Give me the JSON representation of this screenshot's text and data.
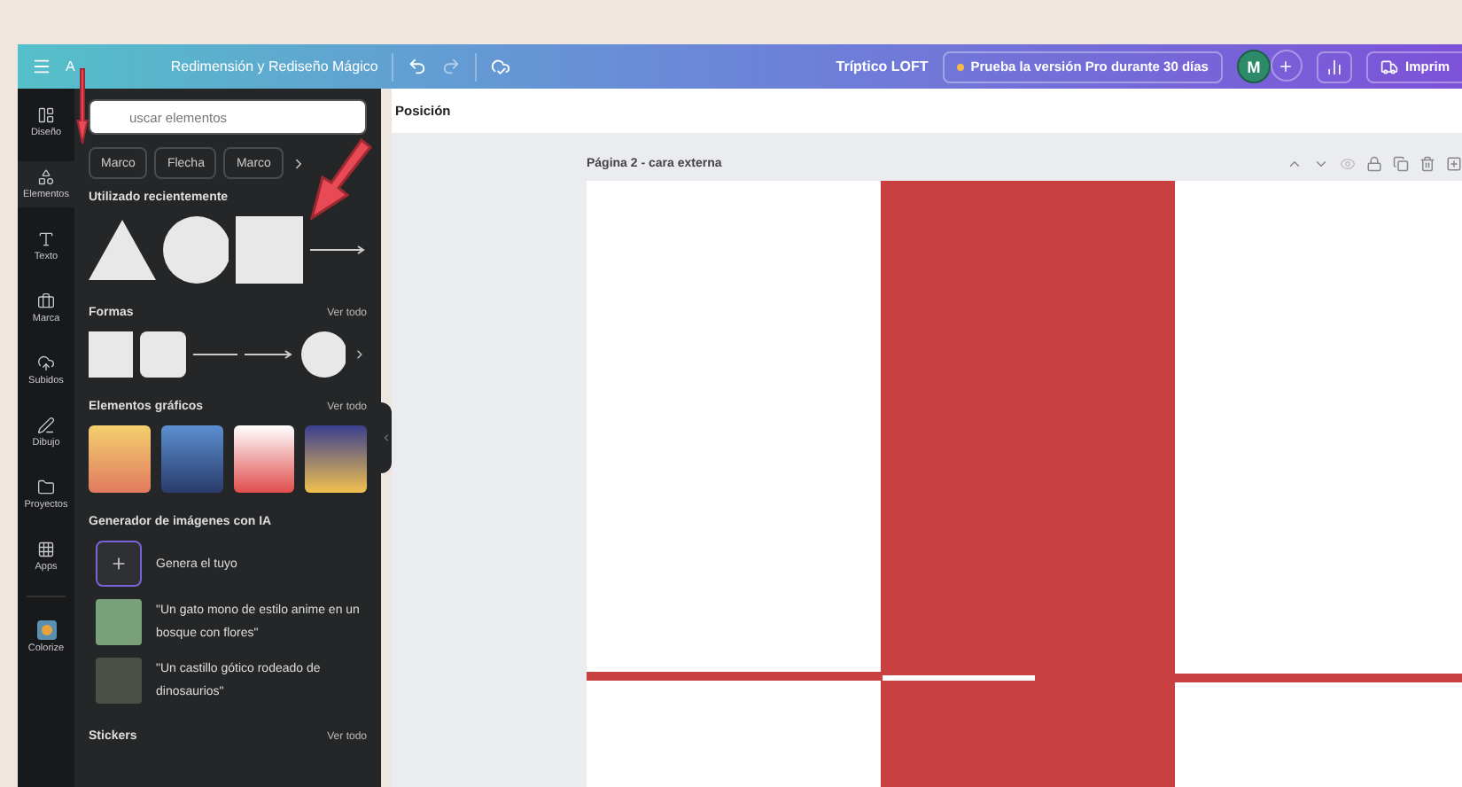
{
  "topbar": {
    "title_prefix": "A",
    "title": "Redimensión y Rediseño Mágico",
    "doc_name": "Tríptico LOFT",
    "pro_button": "Prueba la versión Pro durante 30 días",
    "avatar": "M",
    "print_button": "Imprim"
  },
  "rail": [
    {
      "label": "Diseño",
      "selected": false
    },
    {
      "label": "Elementos",
      "selected": true
    },
    {
      "label": "Texto",
      "selected": false
    },
    {
      "label": "Marca",
      "selected": false
    },
    {
      "label": "Subidos",
      "selected": false
    },
    {
      "label": "Dibujo",
      "selected": false
    },
    {
      "label": "Proyectos",
      "selected": false
    },
    {
      "label": "Apps",
      "selected": false
    },
    {
      "label": "Colorize",
      "selected": false
    }
  ],
  "panel": {
    "search": {
      "placeholder": "uscar elementos"
    },
    "chips": [
      "Marco",
      "Flecha",
      "Marco"
    ],
    "recent": {
      "title": "Utilizado recientemente",
      "shapes": [
        {
          "kind": "triangle"
        },
        {
          "kind": "circle"
        },
        {
          "kind": "square"
        },
        {
          "kind": "arrow"
        }
      ]
    },
    "shapes": {
      "title": "Formas",
      "see_all": "Ver todo",
      "items": [
        {
          "kind": "square"
        },
        {
          "kind": "rounded"
        },
        {
          "kind": "line"
        },
        {
          "kind": "arrow"
        },
        {
          "kind": "circle"
        }
      ]
    },
    "graphics": {
      "title": "Elementos gráficos",
      "see_all": "Ver todo"
    },
    "ai": {
      "title": "Generador de imágenes con IA",
      "generate": "Genera el tuyo",
      "prompts": [
        "\"Un gato mono de estilo anime en un bosque con flores\"",
        "\"Un castillo gótico rodeado de dinosaurios\""
      ]
    },
    "stickers": {
      "title": "Stickers",
      "see_all": "Ver todo"
    }
  },
  "toolbar": {
    "position": "Posición"
  },
  "page": {
    "title": "Página 2 - cara externa"
  }
}
